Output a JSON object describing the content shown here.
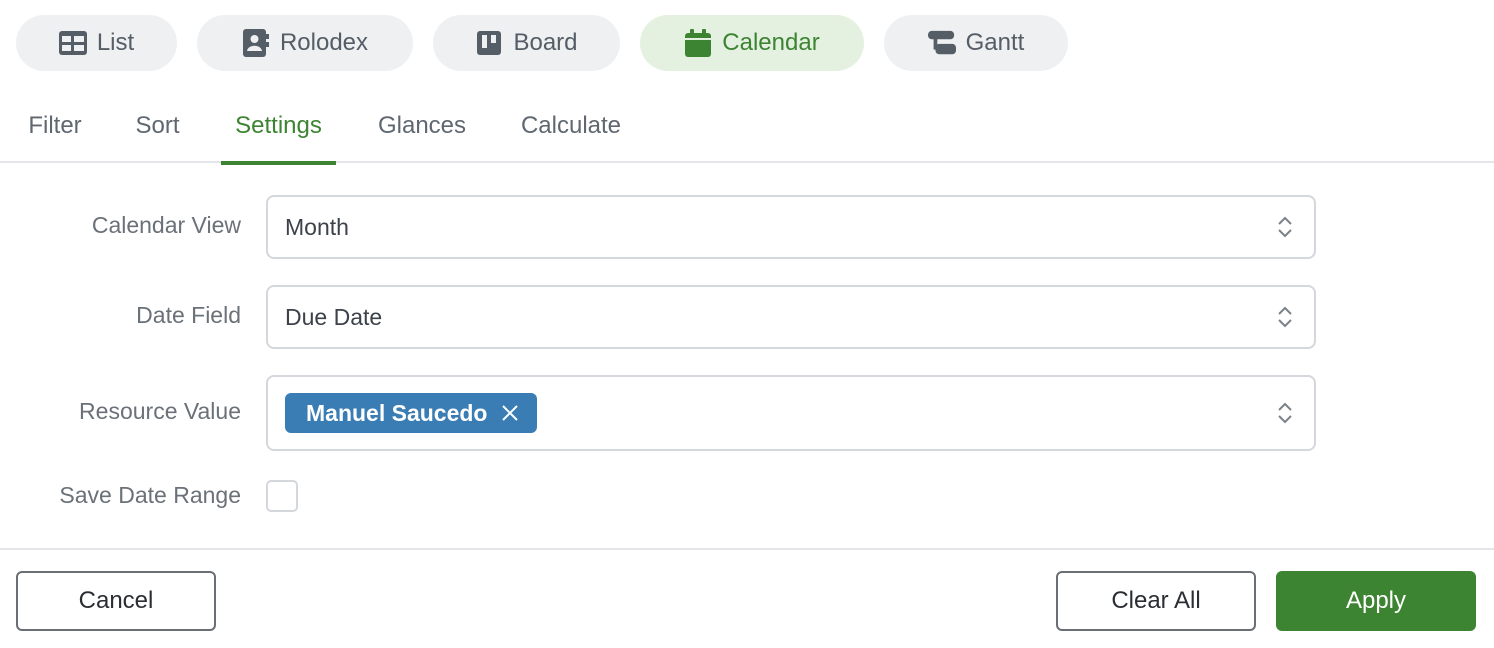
{
  "view_tabs": [
    {
      "label": "List",
      "icon": "list-grid-icon",
      "active": false
    },
    {
      "label": "Rolodex",
      "icon": "contact-card-icon",
      "active": false
    },
    {
      "label": "Board",
      "icon": "kanban-board-icon",
      "active": false
    },
    {
      "label": "Calendar",
      "icon": "calendar-icon",
      "active": true
    },
    {
      "label": "Gantt",
      "icon": "gantt-icon",
      "active": false
    }
  ],
  "sub_tabs": [
    {
      "label": "Filter",
      "active": false
    },
    {
      "label": "Sort",
      "active": false
    },
    {
      "label": "Settings",
      "active": true
    },
    {
      "label": "Glances",
      "active": false
    },
    {
      "label": "Calculate",
      "active": false
    }
  ],
  "settings": {
    "calendar_view": {
      "label": "Calendar View",
      "value": "Month"
    },
    "date_field": {
      "label": "Date Field",
      "value": "Due Date"
    },
    "resource_value": {
      "label": "Resource Value",
      "chips": [
        "Manuel Saucedo"
      ]
    },
    "save_date_range": {
      "label": "Save Date Range",
      "checked": false
    }
  },
  "footer": {
    "cancel_label": "Cancel",
    "clear_all_label": "Clear All",
    "apply_label": "Apply"
  },
  "colors": {
    "accent_green": "#3d8432",
    "chip_blue": "#3a7db4"
  }
}
